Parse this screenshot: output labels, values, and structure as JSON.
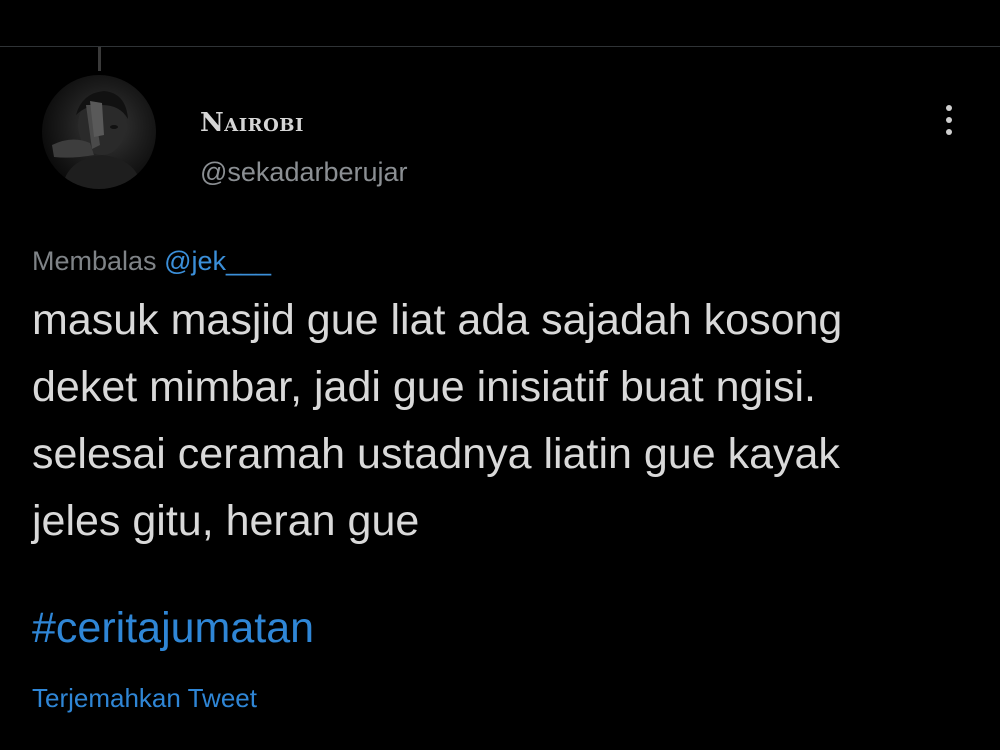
{
  "tweet": {
    "author": {
      "display_name": "Nairobi",
      "handle": "@sekadarberujar",
      "avatar": "avatar"
    },
    "more_icon": "more-vertical-icon",
    "replying_label": "Membalas",
    "replying_mention": "@jek___",
    "text_lines": [
      "masuk masjid gue liat ada sajadah kosong",
      "deket mimbar, jadi gue inisiatif buat ngisi.",
      "selesai ceramah ustadnya liatin gue kayak",
      "jeles gitu, heran gue"
    ],
    "hashtag": "#ceritajumatan",
    "translate_label": "Terjemahkan Tweet"
  },
  "colors": {
    "background": "#000000",
    "text": "#d9d9d9",
    "secondary": "#8b8f93",
    "link": "#2f86d6",
    "divider": "#2f3336"
  }
}
